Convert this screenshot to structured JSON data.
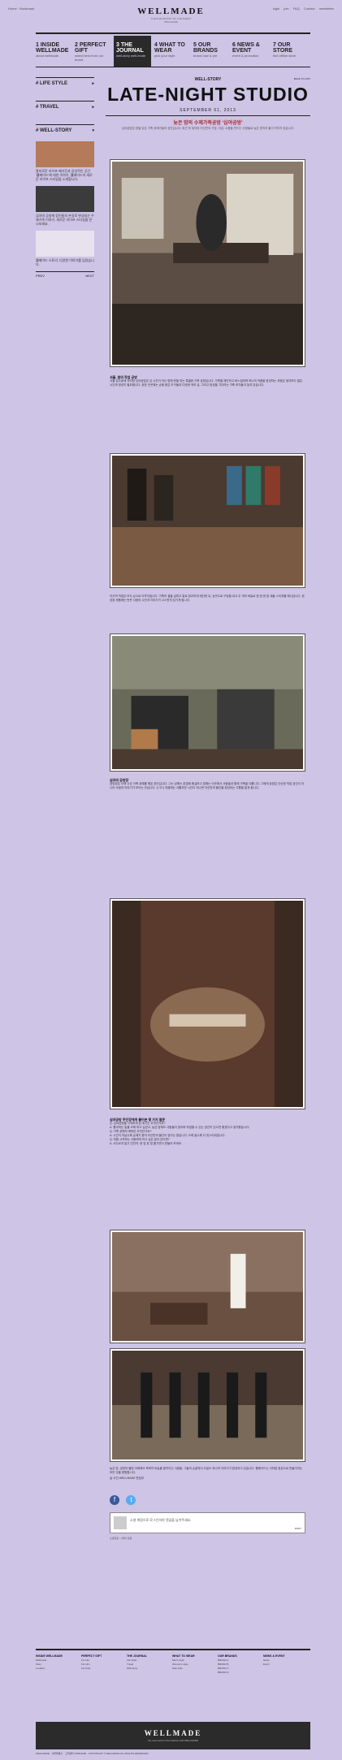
{
  "topbar": {
    "left": "Home · Bookmark",
    "right": [
      "login",
      "join",
      "FAQ",
      "Contact",
      "newsletter"
    ]
  },
  "logo": {
    "name": "WELLMADE",
    "tag1": "THE PHILOSOPHY OF THE FINEST",
    "tag2": "WELLMADE"
  },
  "nav": [
    {
      "num": "1",
      "label": "INSIDE WELLMADE",
      "sub": "about wellmade"
    },
    {
      "num": "2",
      "label": "PERFECT GIFT",
      "sub": "select item from our brand"
    },
    {
      "num": "3",
      "label": "THE JOURNAL",
      "sub": "well-story well-mode"
    },
    {
      "num": "4",
      "label": "WHAT TO WEAR",
      "sub": "pick your style"
    },
    {
      "num": "5",
      "label": "OUR BRANDS",
      "sub": "brand now & pre"
    },
    {
      "num": "6",
      "label": "NEWS & EVENT",
      "sub": "event & promotion"
    },
    {
      "num": "7",
      "label": "OUR STORE",
      "sub": "find offline store"
    }
  ],
  "sidebar": {
    "sections": [
      "# LIFE STYLE",
      "# TRAVEL",
      "# WELL-STORY"
    ],
    "stories": [
      "흥미로운 라이프 매거진과 감성적인 공간 '웰메이드'에 대한 이야기, 웰메이드의 새로운 라이프 스타일을 소개합니다.",
      "심야의 공방에 장인들의 손길로 완성되는 수제가죽 이야기, 새로운 라이프 스타일을 만나보세요.",
      "웰메이드 스토리, 다양한 이야기를 담았습니다."
    ],
    "prev": "PREV",
    "next": "NEXT"
  },
  "crumb": {
    "center": "WELL-STORY",
    "back": "BACK TO LIST"
  },
  "article": {
    "title": "LATE-NIGHT STUDIO",
    "date": "SEPTEMBER 01, 2013",
    "subtitle": "늦은 밤의 수제가죽공방 '심야공방'",
    "intro": "심야공방은 밤을 잊은 가죽 공예가들의 공간입니다. 퇴근 후 찾아와 자신만의 가방, 지갑, 소품을 만드는 사람들로 늦은 밤까지 불이 꺼지지 않습니다.",
    "p1_head": "서울, 밤의 작업 공방",
    "p1": "서울 성수동에 자리한 심야공방은 낮 시간이 아닌 밤에 문을 여는 특별한 가죽 공방입니다. 가죽을 재단하고 바느질하며 하나의 작품을 완성하는 과정은 생각보다 많은 시간과 정성이 필요합니다. 공방 곳곳에는 손때 묻은 도구들과 다양한 색의 실, 그리고 완성을 기다리는 가죽 조각들이 놓여 있습니다.",
    "p2": "이곳의 작업은 모두 손으로 이루어집니다. 가죽의 결을 살피고 칼로 정교하게 재단한 뒤, 송곳으로 구멍을 내고 두 개의 바늘로 한 땀 한 땀 새들 스티치를 해나갑니다. 완성된 제품에는 만든 사람의 시간과 이야기가 고스란히 담기게 됩니다.",
    "p3_head": "심야의 공방장",
    "p3": "공방장은 오랜 시간 가죽 공예를 해온 장인입니다. 그는 낮에는 본업에 충실하고 밤에는 이곳에서 사람들과 함께 가죽을 다룹니다. 그에게 공방은 단순한 작업 공간이 아니라 사람과 이야기가 모이는 곳입니다. 누구나 처음에는 서툴지만 시간이 지나면 자신만의 물건을 완성하는 기쁨을 알게 됩니다.",
    "qa_head": "심야공방 주인장에게 물어본 몇 가지 질문",
    "qa": [
      "Q. 심야공방을 시작하게 된 계기는 무엇인가요?",
      "A. 좋아하는 일을 오래 하고 싶었고, 늦은 밤에도 사람들이 찾아와 작업할 수 있는 공간이 있으면 좋겠다고 생각했습니다.",
      "Q. 가죽 공예의 매력은 무엇인가요?",
      "A. 시간이 지날수록 손때가 묻어 자신만의 물건이 된다는 점입니다. 오래 쓸수록 더 멋스러워집니다.",
      "Q. 처음 시작하는 사람에게 하고 싶은 말이 있다면?",
      "A. 서두르지 말고 천천히, 한 땀 한 땀 즐기면서 만들어 보세요."
    ],
    "p4": "늦은 밤, 공방의 불빛 아래에서 묵묵히 바늘을 움직이는 사람들. 그들의 손끝에서 오늘도 하나의 이야기가 완성되고 있습니다. 웰메이드는 이처럼 정성으로 만들어지는 모든 것을 응원합니다.",
    "sign": "글·사진 WELLMADE 편집부"
  },
  "comment": {
    "placeholder": "소셜 계정으로 로그인하여 댓글을 남겨주세요.",
    "post": "POST",
    "sub": "소셜댓글 · 0개의 댓글"
  },
  "social": {
    "facebook": "f",
    "twitter": "t"
  },
  "footer": {
    "cols": [
      {
        "head": "INSIDE WELLMADE",
        "items": [
          "Wellmade",
          "Story",
          "Location"
        ]
      },
      {
        "head": "PERFECT GIFT",
        "items": [
          "For Her",
          "For Him",
          "For Kids"
        ]
      },
      {
        "head": "THE JOURNAL",
        "items": [
          "Life Style",
          "Travel",
          "Well-story"
        ]
      },
      {
        "head": "WHAT TO WEAR",
        "items": [
          "Men's style",
          "Women's style",
          "Kids style"
        ]
      },
      {
        "head": "OUR BRANDS",
        "items": [
          "BRAND A",
          "BRAND B",
          "BRAND C",
          "BRAND D"
        ]
      },
      {
        "head": "NEWS & EVENT",
        "items": [
          "News",
          "Event"
        ]
      }
    ],
    "banner_name": "WELLMADE",
    "banner_tag": "the new world of fine fashion with WELLMADE",
    "copyright": "WELLMADE · 서울특별시 · 고객센터 1588-0000 · COPYRIGHT © WELLMADE ALL RIGHTS RESERVED"
  }
}
